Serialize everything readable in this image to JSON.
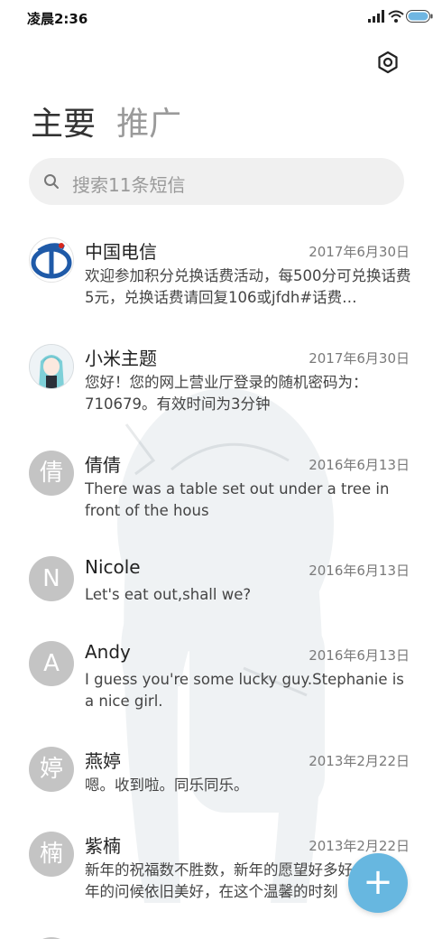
{
  "status_bar": {
    "time": "凌晨2:36"
  },
  "tabs": [
    {
      "label": "主要",
      "active": true
    },
    {
      "label": "推广",
      "active": false
    }
  ],
  "search": {
    "placeholder": "搜索11条短信"
  },
  "messages": [
    {
      "sender": "中国电信",
      "date": "2017年6月30日",
      "snippet": "欢迎参加积分兑换话费活动，每500分可兑换话费5元，兑换话费请回复106或jfdh#话费…",
      "avatar_text": "",
      "avatar_type": "china-telecom-logo"
    },
    {
      "sender": "小米主题",
      "date": "2017年6月30日",
      "snippet": "您好！您的网上营业厅登录的随机密码为：710679。有效时间为3分钟",
      "avatar_text": "",
      "avatar_type": "anime-portrait"
    },
    {
      "sender": "倩倩",
      "date": "2016年6月13日",
      "snippet": "There was a table set out under a tree in front of the hous",
      "avatar_text": "倩",
      "avatar_type": "letter"
    },
    {
      "sender": "Nicole",
      "date": "2016年6月13日",
      "snippet": "Let's eat out,shall we?",
      "avatar_text": "N",
      "avatar_type": "letter"
    },
    {
      "sender": "Andy",
      "date": "2016年6月13日",
      "snippet": "I guess you're some lucky guy.Stephanie is a nice girl.",
      "avatar_text": "A",
      "avatar_type": "letter"
    },
    {
      "sender": "燕婷",
      "date": "2013年2月22日",
      "snippet": "嗯。收到啦。同乐同乐。",
      "avatar_text": "婷",
      "avatar_type": "letter"
    },
    {
      "sender": "紫楠",
      "date": "2013年2月22日",
      "snippet": "新年的祝福数不胜数，新年的愿望好多好多，新年的问候依旧美好，在这个温馨的时刻",
      "avatar_text": "楠",
      "avatar_type": "letter"
    },
    {
      "sender": "",
      "date": "",
      "snippet": "",
      "avatar_text": "",
      "avatar_type": "letter"
    }
  ],
  "fab": {
    "icon": "plus-icon",
    "label": "+"
  },
  "colors": {
    "accent": "#67b7e0",
    "avatar_bg": "#c4c4c4",
    "telecom_blue": "#1f5aa8",
    "telecom_red": "#d7261c"
  }
}
